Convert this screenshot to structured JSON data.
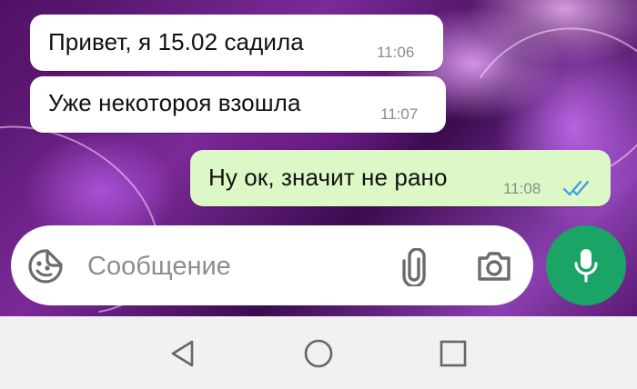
{
  "messages": [
    {
      "direction": "incoming",
      "text": "Привет, я 15.02 садила",
      "time": "11:06"
    },
    {
      "direction": "incoming",
      "text": "Уже некотороя взошла",
      "time": "11:07"
    },
    {
      "direction": "outgoing",
      "text": "Ну ок, значит не рано",
      "time": "11:08",
      "status_icon": "double-check-icon",
      "status_color": "#3a9be8"
    }
  ],
  "composer": {
    "placeholder": "Сообщение",
    "value": "",
    "icons": [
      "sticker-icon",
      "attach-paperclip-icon",
      "camera-icon"
    ],
    "send_button_icon": "microphone-icon",
    "send_button_color": "#1aa466"
  },
  "navigation": {
    "buttons": [
      "back-triangle-icon",
      "home-circle-icon",
      "recents-square-icon"
    ]
  }
}
